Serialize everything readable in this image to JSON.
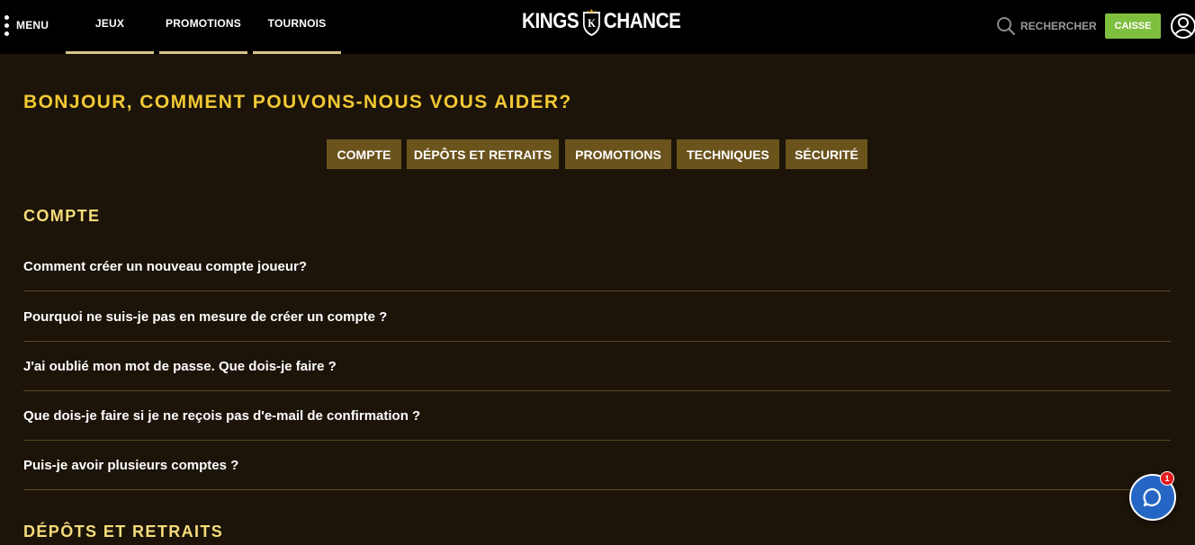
{
  "header": {
    "menu_label": "MENU",
    "nav": [
      {
        "label": "JEUX"
      },
      {
        "label": "PROMOTIONS"
      },
      {
        "label": "TOURNOIS"
      }
    ],
    "logo_left": "KINGS",
    "logo_mark": "K",
    "logo_right": "CHANCE",
    "search_label": "RECHERCHER",
    "cashier_label": "CAISSE"
  },
  "main": {
    "title": "BONJOUR, COMMENT POUVONS-NOUS VOUS AIDER?",
    "category_tabs": [
      {
        "label": "COMPTE"
      },
      {
        "label": "DÉPÔTS ET RETRAITS"
      },
      {
        "label": "PROMOTIONS"
      },
      {
        "label": "TECHNIQUES"
      },
      {
        "label": "SÉCURITÉ"
      }
    ],
    "sections": [
      {
        "title": "COMPTE",
        "questions": [
          "Comment créer un nouveau compte joueur?",
          "Pourquoi ne suis-je pas en mesure de créer un compte ?",
          "J'ai oublié mon mot de passe. Que dois-je faire ?",
          "Que dois-je faire si je ne reçois pas d'e-mail de confirmation ?",
          "Puis-je avoir plusieurs comptes ?"
        ]
      },
      {
        "title": "DÉPÔTS ET RETRAITS"
      }
    ]
  },
  "chat": {
    "badge_count": "1"
  },
  "colors": {
    "background": "#1c1409",
    "topbar": "#000000",
    "accent_yellow": "#f2c935",
    "tab_bg": "#6b531c",
    "cashier_green": "#7fbf3f",
    "chat_blue": "#2566c4"
  }
}
